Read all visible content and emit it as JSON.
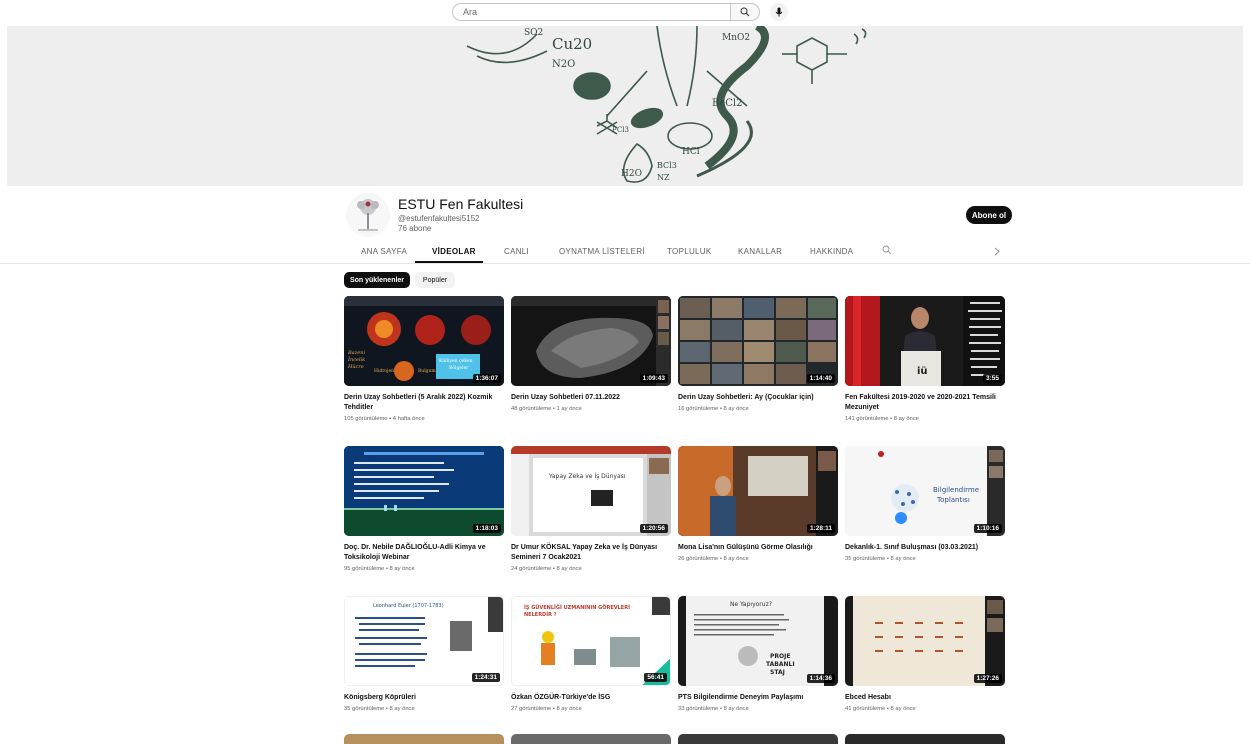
{
  "search": {
    "placeholder": "Ara"
  },
  "channel": {
    "name": "ESTU Fen Fakultesi",
    "handle": "@estufenfakultesi5152",
    "subscribers": "76 abone",
    "subscribe_label": "Abone ol"
  },
  "banner_text": [
    "SO2",
    "Cu20",
    "N2O",
    "MnO2",
    "BeCl2",
    "FCl3",
    "HCl",
    "BCl3",
    "NZ",
    "H2O"
  ],
  "tabs": [
    {
      "label": "ANA SAYFA"
    },
    {
      "label": "VİDEOLAR"
    },
    {
      "label": "CANLI"
    },
    {
      "label": "OYNATMA LİSTELERİ"
    },
    {
      "label": "TOPLULUK"
    },
    {
      "label": "KANALLAR"
    },
    {
      "label": "HAKKINDA"
    }
  ],
  "chips": [
    {
      "label": "Son yüklenenler"
    },
    {
      "label": "Popüler"
    }
  ],
  "videos": [
    {
      "title": "Derin Uzay Sohbetleri (5 Aralık 2022) Kozmik Tehditler",
      "meta": "105 görüntüleme • 4 hafta önce",
      "duration": "1:36:07",
      "thumb_color": "#101820"
    },
    {
      "title": "Derin Uzay Sohbetleri 07.11.2022",
      "meta": "48 görüntüleme • 1 ay önce",
      "duration": "1:09:43",
      "thumb_color": "#1a1a1a"
    },
    {
      "title": "Derin Uzay Sohbetleri: Ay (Çocuklar için)",
      "meta": "16 görüntüleme • 8 ay önce",
      "duration": "1:14:40",
      "thumb_color": "#2a2f35"
    },
    {
      "title": "Fen Fakültesi 2019-2020 ve 2020-2021 Temsili Mezuniyet",
      "meta": "141 görüntüleme • 8 ay önce",
      "duration": "3:55",
      "thumb_color": "#1c1c1c"
    },
    {
      "title": "Doç. Dr. Nebile DAĞLIOĞLU-Adli Kimya ve Toksikoloji Webinar",
      "meta": "95 görüntüleme • 8 ay önce",
      "duration": "1:18:03",
      "thumb_color": "#1e4d36"
    },
    {
      "title": "Dr Umur KÖKSAL Yapay Zeka ve İş Dünyası Semineri 7 Ocak2021",
      "meta": "24 görüntüleme • 8 ay önce",
      "duration": "1:20:56",
      "thumb_color": "#e9e9e9"
    },
    {
      "title": "Mona Lisa'nın Gülüşünü Görme Olasılığı",
      "meta": "26 görüntüleme • 8 ay önce",
      "duration": "1:28:11",
      "thumb_color": "#3b2a20"
    },
    {
      "title": "Dekanlık-1. Sınıf Buluşması (03.03.2021)",
      "meta": "35 görüntüleme • 8 ay önce",
      "duration": "1:10:16",
      "thumb_color": "#f4f4f4"
    },
    {
      "title": "Königsberg Köprüleri",
      "meta": "35 görüntüleme • 8 ay önce",
      "duration": "1:24:31",
      "thumb_color": "#ffffff"
    },
    {
      "title": "Özkan ÖZGÜR-Türkiye'de İSG",
      "meta": "27 görüntüleme • 8 ay önce",
      "duration": "56:41",
      "thumb_color": "#ffffff"
    },
    {
      "title": "PTS Bilgilendirme Deneyim Paylaşımı",
      "meta": "33 görüntüleme • 8 ay önce",
      "duration": "1:14:36",
      "thumb_color": "#f2f2f2"
    },
    {
      "title": "Ebced Hesabı",
      "meta": "41 görüntüleme • 8 ay önce",
      "duration": "1:27:26",
      "thumb_color": "#efe9dc"
    }
  ],
  "thumb_text": {
    "v1": [
      "Bazeni",
      "İncelik",
      "Hücre",
      "Hidrojen",
      "Bulgum",
      "Külliyen çeken",
      "Bölgeler"
    ],
    "v4": "iü",
    "v6": "Yapay Zeka ve İş Dünyası",
    "v8": [
      "Bilgilendirme",
      "Toplantısı"
    ],
    "v9": "Leonhard Euler (1707-1783)",
    "v10": [
      "İŞ GÜVENLİĞİ UZMANININ GÖREVLERİ",
      "NELERDİR ?"
    ],
    "v11": [
      "Ne Yapıyoruz?",
      "PROJE",
      "TABANLI",
      "STAJ"
    ]
  },
  "icons": {
    "search": "search-icon",
    "mic": "microphone-icon",
    "tab_search": "search-icon",
    "chevron": "chevron-right-icon"
  }
}
